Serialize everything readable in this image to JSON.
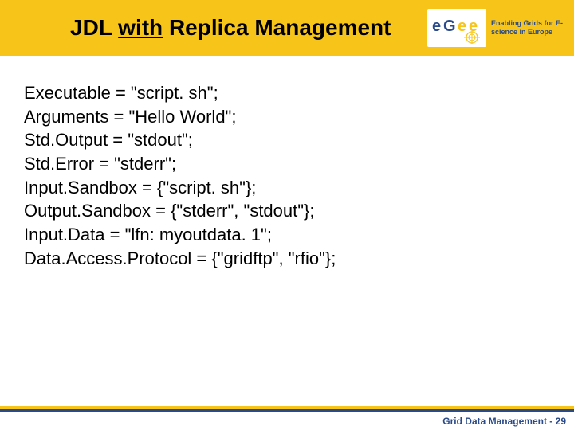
{
  "header": {
    "title_pre": "JDL ",
    "title_underline": "with",
    "title_post": " Replica Management",
    "logo_alt": "eGee",
    "tagline": "Enabling Grids for E-science in Europe"
  },
  "code": {
    "lines": [
      "Executable = \"script. sh\";",
      "Arguments = \"Hello World\";",
      "Std.Output = \"stdout\";",
      "Std.Error = \"stderr\";",
      "Input.Sandbox = {\"script. sh\"};",
      "Output.Sandbox = {\"stderr\", \"stdout\"};",
      "Input.Data = \"lfn: myoutdata. 1\";",
      "Data.Access.Protocol = {\"gridftp\", \"rfio\"};"
    ]
  },
  "footer": {
    "text": "Grid Data Management - 29"
  }
}
